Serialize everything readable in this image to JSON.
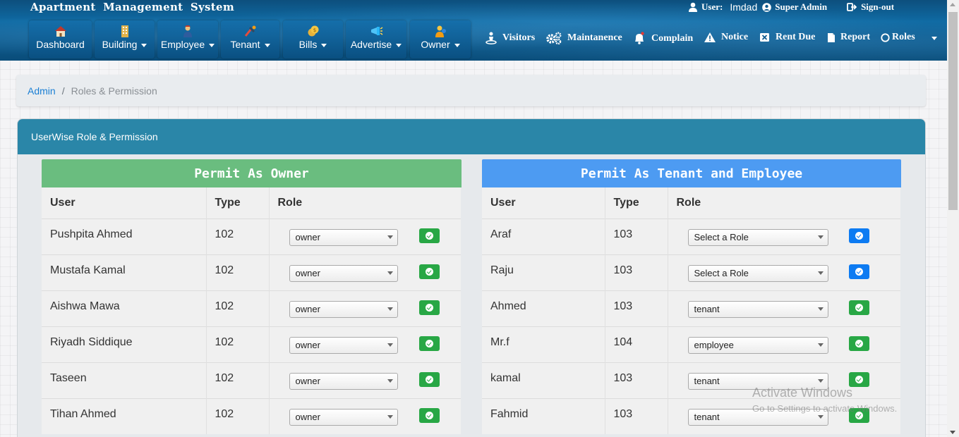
{
  "app": {
    "title": "Apartment  Management  System"
  },
  "topbar": {
    "user_label": "User:",
    "user_name": "Imdad",
    "role_label": "Super Admin",
    "signout_label": "Sign-out"
  },
  "nav": {
    "dashboard": "Dashboard",
    "building": "Building",
    "employee": "Employee",
    "tenant": "Tenant",
    "bills": "Bills",
    "advertise": "Advertise",
    "owner": "Owner",
    "visitors": "Visitors",
    "maintanence": "Maintanence",
    "complain": "Complain",
    "notice": "Notice",
    "rent_due": "Rent Due",
    "report": "Report",
    "roles": "Roles"
  },
  "breadcrumb": {
    "root": "Admin",
    "separator": "/",
    "current": "Roles & Permission"
  },
  "card": {
    "title": "UserWise Role & Permission"
  },
  "owner_panel": {
    "title": "Permit As Owner",
    "color": "#6abd7f",
    "headers": [
      "User",
      "Type",
      "Role"
    ],
    "rows": [
      {
        "user": "Pushpita Ahmed",
        "type": "102",
        "role": "owner"
      },
      {
        "user": "Mustafa Kamal",
        "type": "102",
        "role": "owner"
      },
      {
        "user": "Aishwa Mawa",
        "type": "102",
        "role": "owner"
      },
      {
        "user": "Riyadh Siddique",
        "type": "102",
        "role": "owner"
      },
      {
        "user": "Taseen",
        "type": "102",
        "role": "owner"
      },
      {
        "user": "Tihan Ahmed",
        "type": "102",
        "role": "owner"
      }
    ]
  },
  "tenant_panel": {
    "title": "Permit As Tenant and Employee",
    "color": "#4d9bf2",
    "headers": [
      "User",
      "Type",
      "Role"
    ],
    "rows": [
      {
        "user": "Araf",
        "type": "103",
        "role": "Select a Role",
        "button": "blue"
      },
      {
        "user": "Raju",
        "type": "103",
        "role": "Select a Role",
        "button": "blue"
      },
      {
        "user": "Ahmed",
        "type": "103",
        "role": "tenant",
        "button": "green"
      },
      {
        "user": "Mr.f",
        "type": "104",
        "role": "employee",
        "button": "green"
      },
      {
        "user": "kamal",
        "type": "103",
        "role": "tenant",
        "button": "green"
      },
      {
        "user": "Fahmid",
        "type": "103",
        "role": "tenant",
        "button": "green"
      }
    ]
  },
  "colors": {
    "green_button": "#28a745",
    "blue_button": "#0d7bf2"
  },
  "watermark": {
    "line1": "Activate Windows",
    "line2": "Go to Settings to activate Windows."
  }
}
